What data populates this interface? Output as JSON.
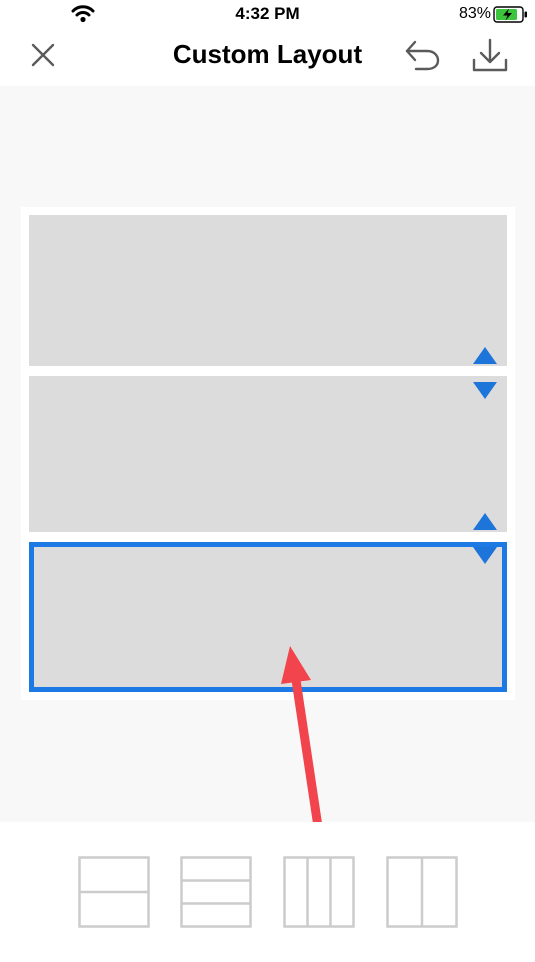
{
  "status_bar": {
    "time": "4:32 PM",
    "battery_percent": "83%",
    "battery_charging": true
  },
  "header": {
    "title": "Custom Layout",
    "icons": [
      "close-icon",
      "undo-icon",
      "download-icon"
    ]
  },
  "layout": {
    "panel_count": 3,
    "selected_panel": 3,
    "colors": {
      "panel": "#dcdcdc",
      "selection_border": "#1d79e4",
      "arrow": "#1d74d9",
      "annotation_arrow": "#f2444d"
    }
  },
  "layout_options": [
    {
      "name": "two-rows-layout-icon"
    },
    {
      "name": "three-rows-layout-icon"
    },
    {
      "name": "three-columns-layout-icon"
    },
    {
      "name": "two-columns-layout-icon"
    }
  ]
}
